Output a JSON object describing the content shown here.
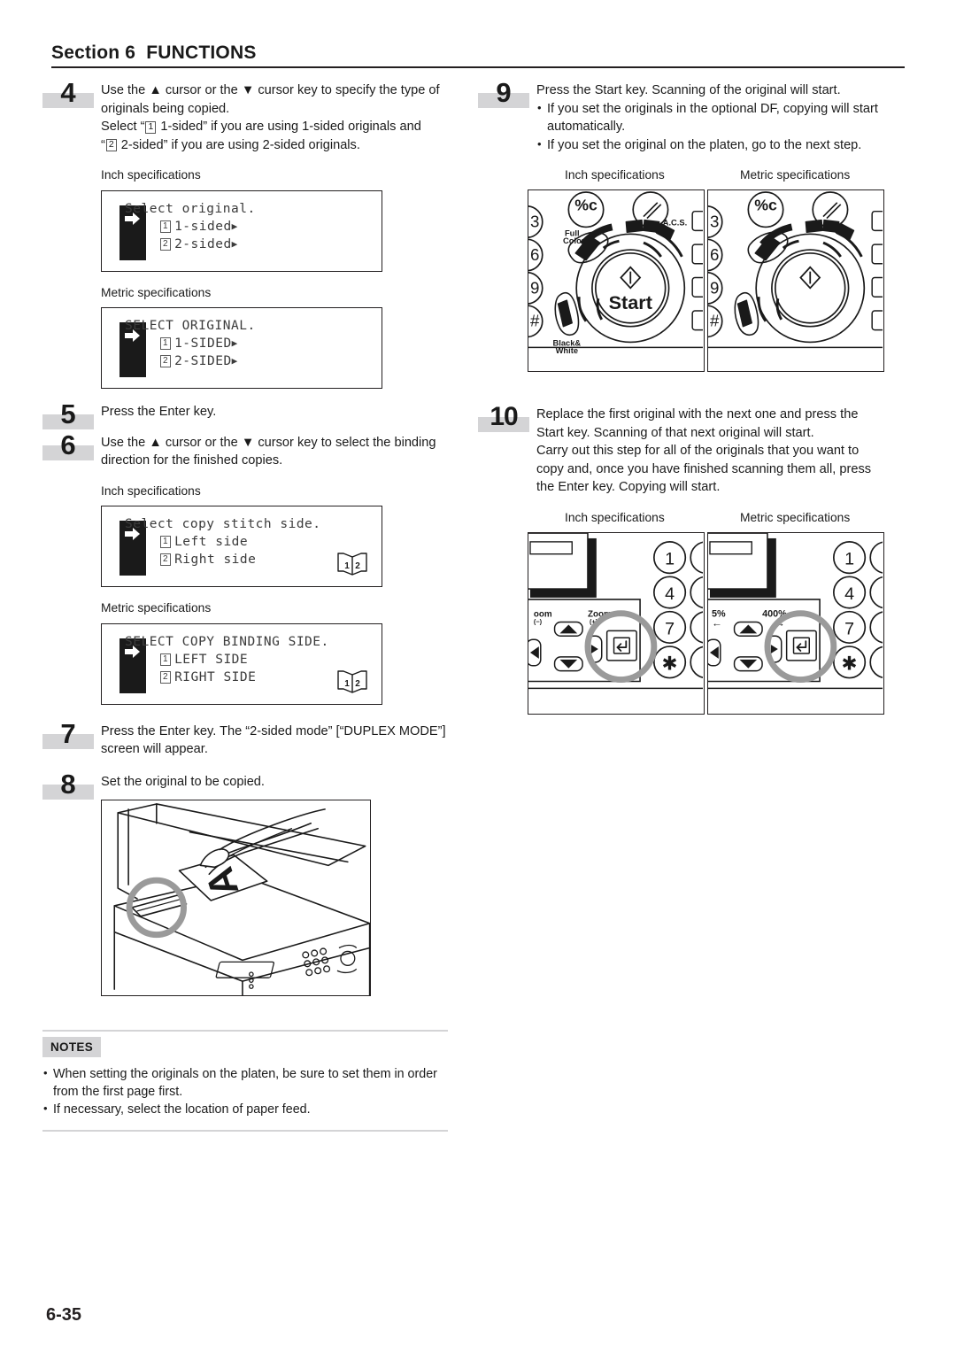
{
  "header": {
    "title": "Section 6  FUNCTIONS"
  },
  "page_number": "6-35",
  "labels": {
    "inch_spec": "Inch specifications",
    "metric_spec": "Metric specifications"
  },
  "steps": {
    "s4": {
      "number": "4",
      "line1_a": "Use the ",
      "line1_up": "▲",
      "line1_b": " cursor or the ",
      "line1_down": "▼",
      "line1_c": " cursor key to specify the type of",
      "line2": "originals being copied.",
      "line3_a": "Select “",
      "line3_key": "1",
      "line3_b": " 1-sided” if you are using 1-sided originals and",
      "line4_a": "“",
      "line4_key": "2",
      "line4_b": " 2-sided” if you are using 2-sided originals."
    },
    "s5": {
      "number": "5",
      "text": "Press the Enter key."
    },
    "s6": {
      "number": "6",
      "line1_a": "Use the ",
      "line1_up": "▲",
      "line1_b": " cursor or the ",
      "line1_down": "▼",
      "line1_c": " cursor key to select the binding",
      "line2": "direction for the finished copies."
    },
    "s7": {
      "number": "7",
      "line1": "Press the Enter key. The “2-sided mode” [“DUPLEX MODE”]",
      "line2": "screen will appear."
    },
    "s8": {
      "number": "8",
      "text": "Set the original to be copied."
    },
    "s9": {
      "number": "9",
      "line1": "Press the Start key. Scanning of the original will start.",
      "bullet1": "If you set the originals in the optional DF, copying will start automatically.",
      "bullet2": "If you set the original on the platen, go to the next step."
    },
    "s10": {
      "number": "10",
      "line1": "Replace the first original with the next one and press the",
      "line2": "Start key. Scanning of that next original will start.",
      "line3": "Carry out this step for all of the originals that you want to",
      "line4": "copy and, once you have finished scanning them all, press",
      "line5": "the Enter key. Copying will start."
    }
  },
  "lcd_screens": {
    "original_inch": {
      "title": "Select original.",
      "option1_num": "1",
      "option1_label": "1-sided",
      "option2_num": "2",
      "option2_label": "2-sided",
      "arrow": "▶"
    },
    "original_metric": {
      "title": "SELECT ORIGINAL.",
      "option1_num": "1",
      "option1_label": "1-SIDED",
      "option2_num": "2",
      "option2_label": "2-SIDED",
      "arrow": "▶"
    },
    "binding_inch": {
      "title": "Select copy stitch side.",
      "option1_num": "1",
      "option1_label": "Left side",
      "option2_num": "2",
      "option2_label": "Right side",
      "book_page_left": "1",
      "book_page_right": "2"
    },
    "binding_metric": {
      "title": "SELECT COPY BINDING SIDE.",
      "option1_num": "1",
      "option1_label": "LEFT SIDE",
      "option2_num": "2",
      "option2_label": "RIGHT SIDE",
      "book_page_left": "1",
      "book_page_right": "2"
    }
  },
  "panel_start_inch": {
    "start_label": "Start",
    "full_color_line1": "Full",
    "full_color_line2": "Color",
    "acs_label": "A.C.S.",
    "bw_line1": "Black&",
    "bw_line2": "White",
    "stop_clear_label": "/C",
    "keypad": [
      "3",
      "6",
      "9",
      "#"
    ]
  },
  "panel_start_metric": {
    "keypad": [
      "3",
      "6",
      "9",
      "#"
    ]
  },
  "panel_enter_inch": {
    "zoom_minus_label": "Zoom",
    "zoom_minus_sub": "(−)",
    "zoom_plus_label": "Zoom",
    "zoom_plus_sub": "(+)",
    "keypad": [
      "1",
      "4",
      "7",
      "✱"
    ]
  },
  "panel_enter_metric": {
    "zoom_minus_label": "5%",
    "zoom_plus_label": "400%",
    "keypad": [
      "1",
      "4",
      "7",
      "✱"
    ]
  },
  "copier_figure": {
    "original_letter": "A"
  },
  "notes": {
    "badge": "NOTES",
    "item1": "When setting the originals on the platen, be sure to set them in order from the first page first.",
    "item2": "If necessary, select the location of paper feed."
  },
  "colors": {
    "ink": "#1a1a1a",
    "gray_bar": "#d4d4d6",
    "highlight_circle": "#9a9a9a",
    "lcd_text": "#3b3b3b"
  }
}
